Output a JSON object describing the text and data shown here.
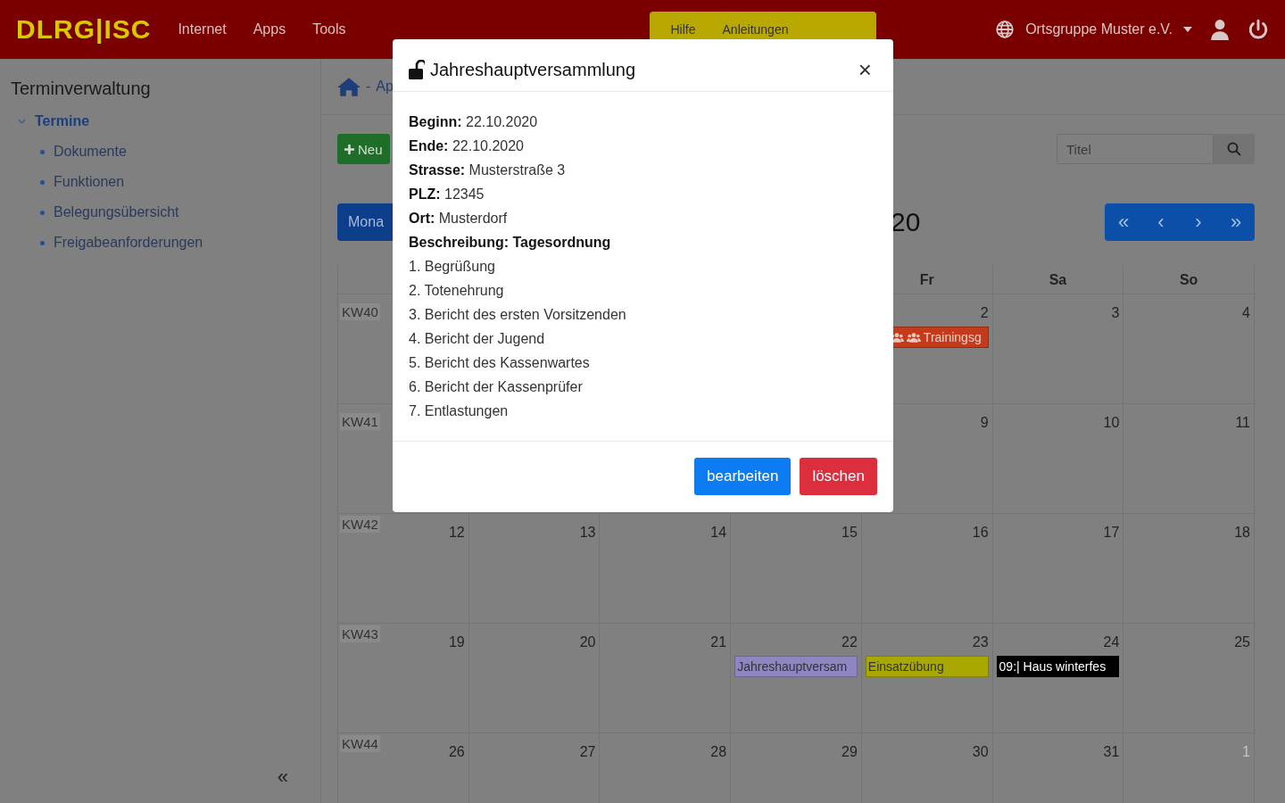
{
  "navbar": {
    "logo": "DLRG|ISC",
    "links": [
      "Internet",
      "Apps",
      "Tools"
    ],
    "help": {
      "items": [
        "Hilfe",
        "Anleitungen"
      ]
    },
    "organization": "Ortsgruppe Muster e.V."
  },
  "sidebar": {
    "title": "Terminverwaltung",
    "items": [
      {
        "label": "Termine",
        "expanded": true,
        "selected": true,
        "children": [
          {
            "label": "Dokumente",
            "selected": false
          },
          {
            "label": "Funktionen",
            "selected": false
          },
          {
            "label": "Belegungsübersicht",
            "selected": false
          },
          {
            "label": "Freigabeanforderungen",
            "selected": false
          }
        ]
      }
    ],
    "collapse": "«"
  },
  "breadcrumb": {
    "separator": "-",
    "item": "Ap"
  },
  "toolbar": {
    "new_button": "Neu",
    "search": {
      "placeholder": "Titel"
    }
  },
  "calendar": {
    "view_button": "Mona",
    "title": "20",
    "nav": [
      "«",
      "‹",
      "›",
      "»"
    ],
    "headers": [
      "Fr",
      "Sa",
      "So"
    ],
    "weeks": [
      {
        "label": "KW40",
        "days": [
          {
            "day": "2",
            "outside": false,
            "events": [
              {
                "title": "Trainingsg",
                "kind": "group",
                "color": "#c43a1a"
              }
            ]
          },
          {
            "day": "3",
            "outside": false
          },
          {
            "day": "4",
            "outside": false
          }
        ]
      },
      {
        "label": "KW41",
        "days": [
          {
            "day": "9",
            "outside": false
          },
          {
            "day": "10",
            "outside": false
          },
          {
            "day": "11",
            "outside": false
          }
        ]
      },
      {
        "label": "KW42",
        "days": [
          {
            "day": "12",
            "outside": false
          },
          {
            "day": "13",
            "outside": false
          },
          {
            "day": "14",
            "outside": false
          },
          {
            "day": "15",
            "outside": false
          },
          {
            "day": "16",
            "outside": false
          },
          {
            "day": "17",
            "outside": false
          },
          {
            "day": "18",
            "outside": false
          }
        ]
      },
      {
        "label": "KW43",
        "days": [
          {
            "day": "19",
            "outside": false
          },
          {
            "day": "20",
            "outside": false
          },
          {
            "day": "21",
            "outside": false
          },
          {
            "day": "22",
            "outside": false,
            "events": [
              {
                "title": "Jahreshauptversam",
                "kind": "plain",
                "color": "#8e86c0"
              }
            ]
          },
          {
            "day": "23",
            "outside": false,
            "events": [
              {
                "title": "Einsatzübung",
                "kind": "plain",
                "color": "#a8a800"
              }
            ]
          },
          {
            "day": "24",
            "outside": false,
            "events": [
              {
                "title": "09:| Haus winterfes",
                "kind": "plain",
                "color": "#000000"
              }
            ]
          },
          {
            "day": "25",
            "outside": false
          }
        ]
      },
      {
        "label": "KW44",
        "days": [
          {
            "day": "26",
            "outside": false
          },
          {
            "day": "27",
            "outside": false
          },
          {
            "day": "28",
            "outside": false
          },
          {
            "day": "29",
            "outside": false
          },
          {
            "day": "30",
            "outside": false
          },
          {
            "day": "31",
            "outside": false
          },
          {
            "day": "1",
            "outside": true
          }
        ]
      }
    ]
  },
  "modal": {
    "title": "Jahreshauptversammlung",
    "close": "×",
    "fields": [
      {
        "label": "Beginn:",
        "value": "22.10.2020"
      },
      {
        "label": "Ende:",
        "value": "22.10.2020"
      },
      {
        "label": "Strasse:",
        "value": "Musterstraße 3"
      },
      {
        "label": "PLZ:",
        "value": "12345"
      },
      {
        "label": "Ort:",
        "value": "Musterdorf"
      }
    ],
    "description": {
      "label": "Beschreibung:",
      "value": "Tagesordnung"
    },
    "agenda": [
      "1. Begrüßung",
      "2. Totenehrung",
      "3. Bericht des ersten Vorsitzenden",
      "4. Bericht der Jugend",
      "5. Bericht des Kassenwartes",
      "6. Bericht der Kassenprüfer",
      "7. Entlastungen"
    ],
    "buttons": [
      {
        "label": "bearbeiten",
        "kind": "primary"
      },
      {
        "label": "löschen",
        "kind": "danger"
      }
    ]
  }
}
